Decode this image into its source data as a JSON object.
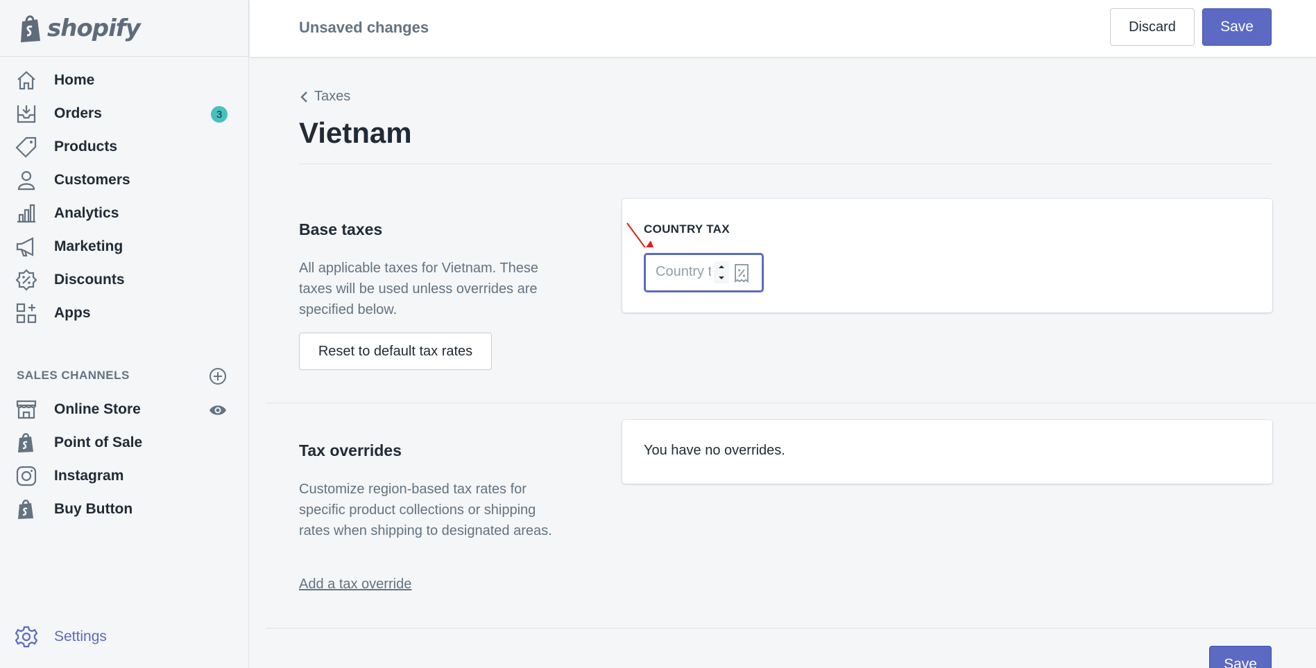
{
  "app": {
    "logo_text": "shopify"
  },
  "sidebar": {
    "items": [
      {
        "label": "Home",
        "icon": "home-icon"
      },
      {
        "label": "Orders",
        "icon": "orders-icon",
        "badge": "3"
      },
      {
        "label": "Products",
        "icon": "tag-icon"
      },
      {
        "label": "Customers",
        "icon": "person-icon"
      },
      {
        "label": "Analytics",
        "icon": "bar-chart-icon"
      },
      {
        "label": "Marketing",
        "icon": "megaphone-icon"
      },
      {
        "label": "Discounts",
        "icon": "discount-icon"
      },
      {
        "label": "Apps",
        "icon": "apps-icon"
      }
    ],
    "sales_channels_title": "SALES CHANNELS",
    "channels": [
      {
        "label": "Online Store",
        "icon": "store-icon"
      },
      {
        "label": "Point of Sale",
        "icon": "shopify-bag-icon"
      },
      {
        "label": "Instagram",
        "icon": "instagram-icon"
      },
      {
        "label": "Buy Button",
        "icon": "shopify-bag-icon"
      }
    ],
    "settings_label": "Settings"
  },
  "topbar": {
    "status": "Unsaved changes",
    "discard_label": "Discard",
    "save_label": "Save"
  },
  "page": {
    "breadcrumb": "Taxes",
    "title": "Vietnam"
  },
  "base_taxes": {
    "heading": "Base taxes",
    "description": "All applicable taxes for Vietnam. These taxes will be used unless overrides are specified below.",
    "reset_label": "Reset to default tax rates",
    "card_label": "COUNTRY TAX",
    "input_placeholder": "Country tax",
    "input_value": ""
  },
  "tax_overrides": {
    "heading": "Tax overrides",
    "description": "Customize region-based tax rates for specific product collections or shipping rates when shipping to designated areas.",
    "empty_text": "You have no overrides.",
    "add_link": "Add a tax override"
  },
  "footer": {
    "save_label": "Save"
  },
  "colors": {
    "accent": "#5c6ac4",
    "badge": "#47c1bf",
    "annotation_arrow": "#e02020"
  }
}
